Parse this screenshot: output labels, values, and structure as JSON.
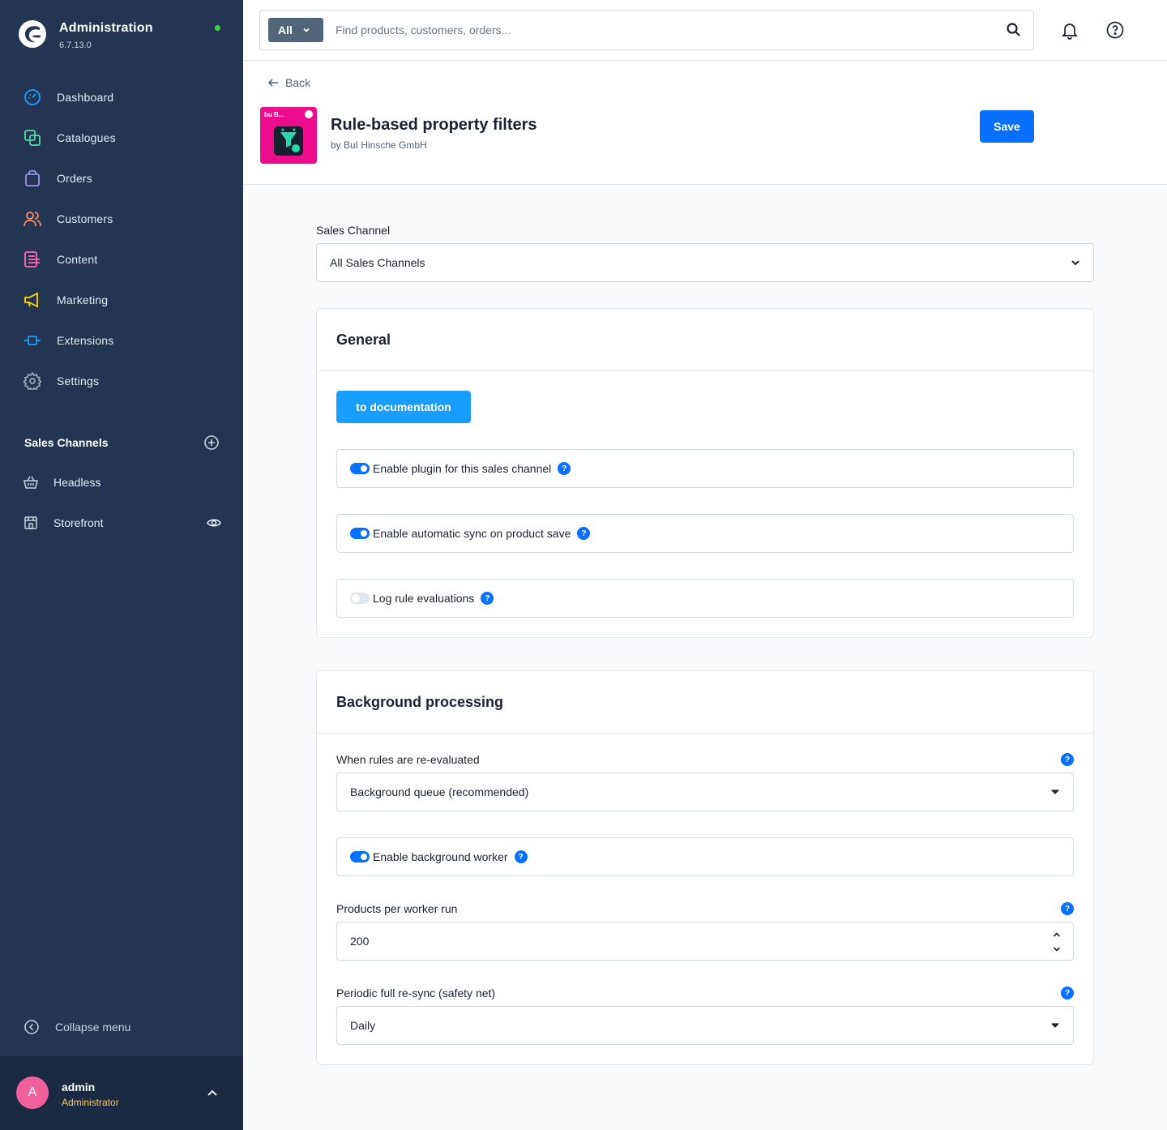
{
  "app": {
    "title": "Administration",
    "version": "6.7.13.0"
  },
  "sidebar": {
    "items": [
      {
        "label": "Dashboard",
        "icon": "dashboard-icon",
        "color": "#189eff"
      },
      {
        "label": "Catalogues",
        "icon": "catalogues-icon",
        "color": "#57d9a3"
      },
      {
        "label": "Orders",
        "icon": "orders-icon",
        "color": "#a092f0"
      },
      {
        "label": "Customers",
        "icon": "customers-icon",
        "color": "#f88962"
      },
      {
        "label": "Content",
        "icon": "content-icon",
        "color": "#ff68b4"
      },
      {
        "label": "Marketing",
        "icon": "marketing-icon",
        "color": "#ffd700"
      },
      {
        "label": "Extensions",
        "icon": "extensions-icon",
        "color": "#189eff"
      },
      {
        "label": "Settings",
        "icon": "settings-icon",
        "color": "#9aa8b5"
      }
    ],
    "sales_channels_title": "Sales Channels",
    "sales_channels": [
      {
        "label": "Headless",
        "icon": "basket-icon"
      },
      {
        "label": "Storefront",
        "icon": "storefront-icon"
      }
    ],
    "collapse_label": "Collapse menu",
    "user": {
      "initial": "A",
      "name": "admin",
      "role": "Administrator"
    }
  },
  "topbar": {
    "search_type": "All",
    "search_placeholder": "Find products, customers, orders..."
  },
  "header": {
    "back_label": "Back",
    "plugin_title": "Rule-based property filters",
    "plugin_author": "by BuI Hinsche GmbH",
    "save_label": "Save"
  },
  "sales_channel_field": {
    "label": "Sales Channel",
    "value": "All Sales Channels"
  },
  "general": {
    "title": "General",
    "doc_button": "to documentation",
    "switches": [
      {
        "label": "Enable plugin for this sales channel",
        "on": true
      },
      {
        "label": "Enable automatic sync on product save",
        "on": true
      },
      {
        "label": "Log rule evaluations",
        "on": false
      }
    ]
  },
  "background": {
    "title": "Background processing",
    "reevaluate": {
      "label": "When rules are re-evaluated",
      "value": "Background queue (recommended)"
    },
    "worker_switch": {
      "label": "Enable background worker",
      "on": true
    },
    "per_run": {
      "label": "Products per worker run",
      "value": "200"
    },
    "resync": {
      "label": "Periodic full re-sync (safety net)",
      "value": "Daily"
    }
  },
  "help_glyph": "?",
  "colors": {
    "sidebar_bg": "#233553",
    "primary": "#0870ff",
    "doc_button": "#189eff",
    "plugin_bg": "#ec0c8c",
    "status_online": "#37d046"
  }
}
